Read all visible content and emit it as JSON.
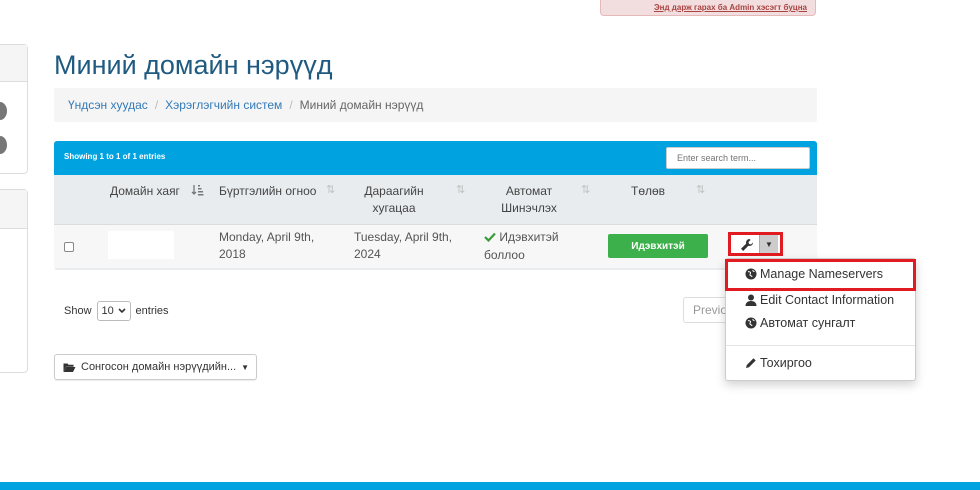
{
  "header": {
    "admin_notice": "Энд дарж гарах ба Admin хэсэгт буцна"
  },
  "page": {
    "title": "Миний домайн нэрүүд"
  },
  "breadcrumb": {
    "items": [
      {
        "label": "Үндсэн хуудас"
      },
      {
        "label": "Хэрэглэгчийн систем"
      },
      {
        "label": "Миний домайн нэрүүд"
      }
    ]
  },
  "table": {
    "showing_text": "Showing 1 to 1 of 1 entries",
    "search_placeholder": "Enter search term...",
    "columns": {
      "domain": "Домайн хаяг",
      "reg_date": "Бүртгэлийн огноо",
      "next_due_1": "Дараагийн",
      "next_due_2": "хугацаа",
      "auto_1": "Автомат",
      "auto_2": "Шинэчлэх",
      "status": "Төлөв"
    },
    "rows": [
      {
        "domain": "",
        "reg_date_1": "Monday, April 9th,",
        "reg_date_2": "2018",
        "next_due_1": "Tuesday, April 9th,",
        "next_due_2": "2024",
        "auto_1": "Идэвхитэй",
        "auto_2": "боллоо",
        "status": "Идэвхитэй"
      }
    ]
  },
  "pagination": {
    "show_label": "Show",
    "entries_value": "10",
    "entries_label": "entries",
    "previous": "Previous"
  },
  "bulk_action": {
    "label": "Сонгосон домайн нэрүүдийн..."
  },
  "dropdown": {
    "items": [
      {
        "label": "Manage Nameservers",
        "icon": "globe-icon"
      },
      {
        "label": "Edit Contact Information",
        "icon": "user-icon"
      },
      {
        "label": "Автомат сунгалт",
        "icon": "globe-icon"
      },
      {
        "label": "Тохиргоо",
        "icon": "pencil-icon"
      }
    ]
  },
  "colors": {
    "accent": "#00a3e0",
    "title": "#1f5a80",
    "success": "#3cb04a",
    "highlight": "#e21b22"
  }
}
